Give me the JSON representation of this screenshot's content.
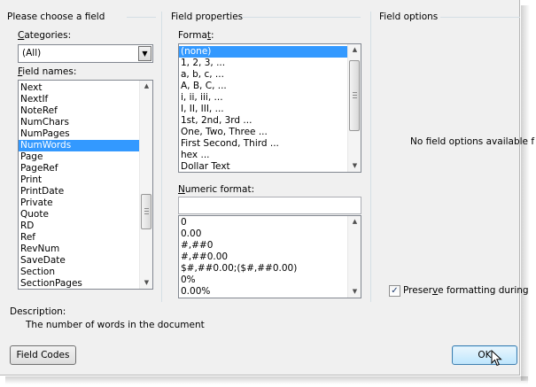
{
  "field_panel": {
    "title": "Please choose a field",
    "categories_label": "Categories:",
    "categories_value": "(All)",
    "field_names_label": "Field names:",
    "field_names": [
      "Next",
      "NextIf",
      "NoteRef",
      "NumChars",
      "NumPages",
      "NumWords",
      "Page",
      "PageRef",
      "Print",
      "PrintDate",
      "Private",
      "Quote",
      "RD",
      "Ref",
      "RevNum",
      "SaveDate",
      "Section",
      "SectionPages"
    ],
    "selected_field": "NumWords"
  },
  "properties_panel": {
    "title": "Field properties",
    "format_label": "Format:",
    "formats": [
      "(none)",
      "1, 2, 3, ...",
      "a, b, c, ...",
      "A, B, C, ...",
      "i, ii, iii, ...",
      "I, II, III, ...",
      "1st, 2nd, 3rd ...",
      "One, Two, Three ...",
      "First Second, Third ...",
      "hex ...",
      "Dollar Text"
    ],
    "selected_format": "(none)",
    "numeric_format_label": "Numeric format:",
    "numeric_format_value": "",
    "numeric_formats": [
      "0",
      "0.00",
      "#,##0",
      "#,##0.00",
      "$#,##0.00;($#,##0.00)",
      "0%",
      "0.00%"
    ]
  },
  "options_panel": {
    "title": "Field options",
    "empty_message": "No field options available f",
    "preserve_label": "Preserve formatting during",
    "preserve_checked": true
  },
  "description": {
    "label": "Description:",
    "text": "The number of words in the document"
  },
  "buttons": {
    "field_codes": "Field Codes",
    "ok": "OK"
  }
}
